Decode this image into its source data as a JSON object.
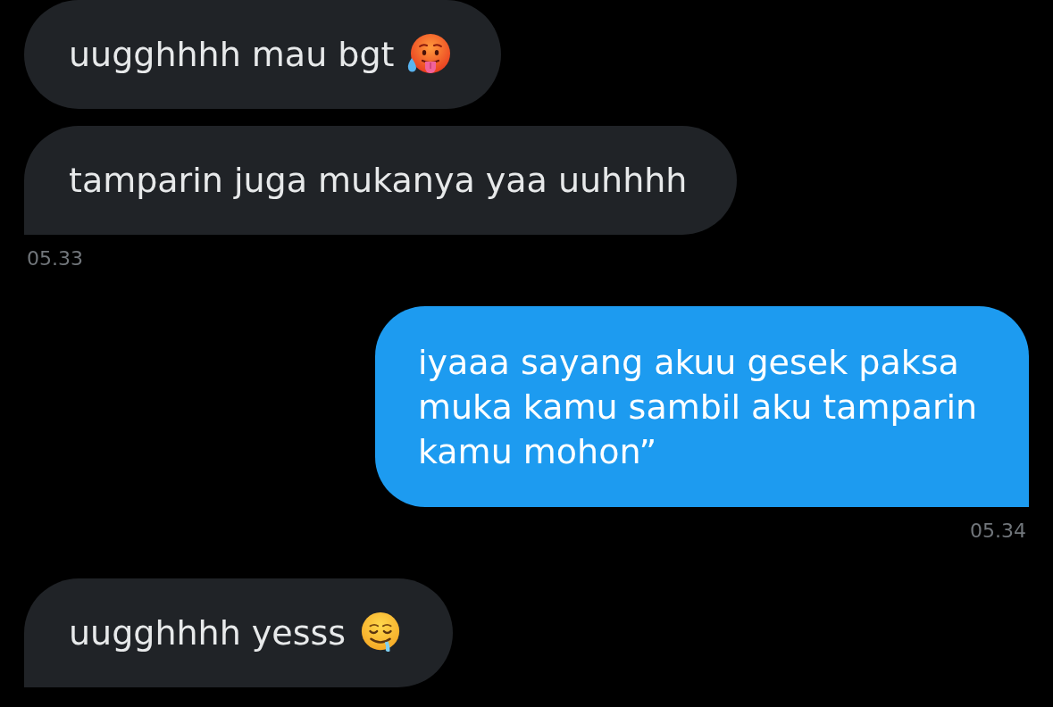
{
  "conversation": {
    "groups": [
      {
        "kind": "received",
        "messages": [
          {
            "kind": "hotface",
            "text": "uugghhhh mau bgt",
            "tail": false
          },
          {
            "kind": "plain",
            "text": "tamparin juga mukanya yaa uuhhhh",
            "tail": true
          }
        ],
        "time": "05.33"
      },
      {
        "kind": "sent",
        "messages": [
          {
            "kind": "plain",
            "text": "iyaaa sayang akuu gesek paksa muka kamu sambil aku tamparin kamu mohon”",
            "tail": true
          }
        ],
        "time": "05.34"
      },
      {
        "kind": "received",
        "messages": [
          {
            "kind": "drool",
            "text": "uugghhhh yesss",
            "tail": true
          }
        ]
      }
    ]
  }
}
